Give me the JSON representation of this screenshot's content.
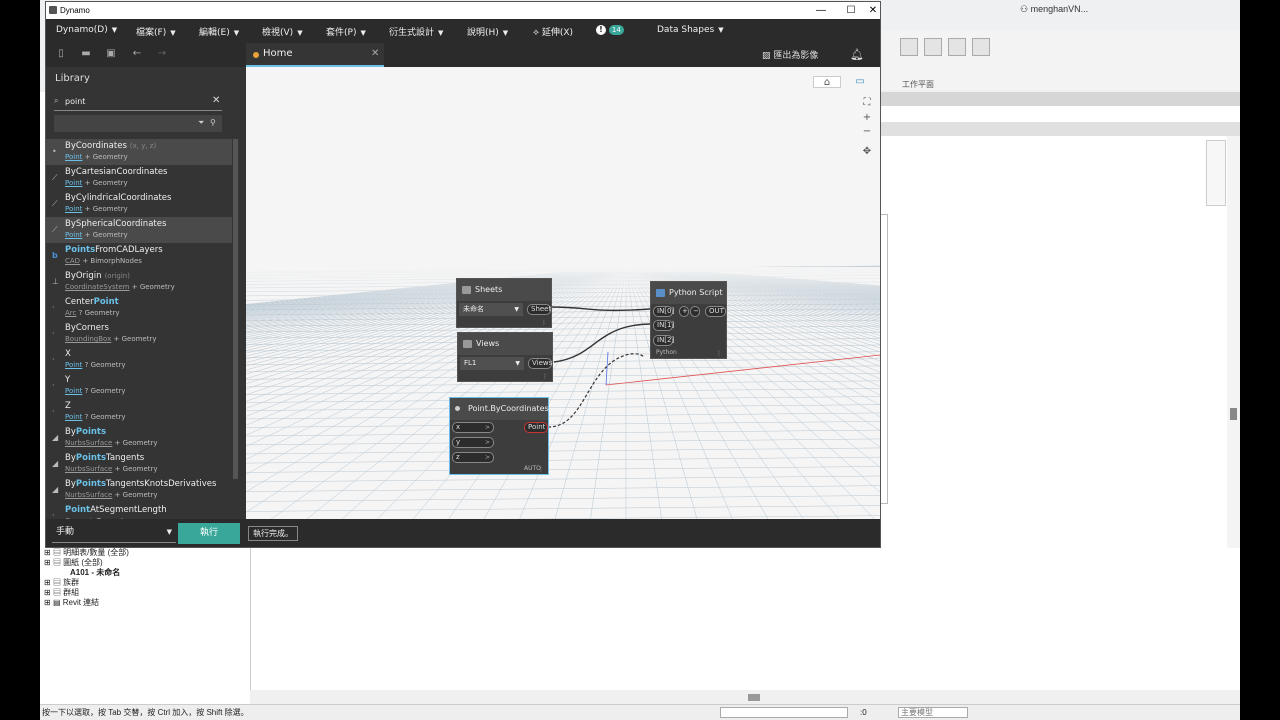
{
  "revit": {
    "user": "menghanVN...",
    "ribbon_panel_label": "工作平面",
    "tree": {
      "items": [
        {
          "label": "明細表/數量 (全部)",
          "bold": false
        },
        {
          "label": "圖紙 (全部)",
          "bold": false
        },
        {
          "label": "A101 - 未命名",
          "bold": true
        },
        {
          "label": "族群",
          "bold": false
        },
        {
          "label": "群組",
          "bold": false
        },
        {
          "label": "Revit 連結",
          "bold": false
        }
      ]
    },
    "status_text": "按一下以選取，按 Tab 交替，按 Ctrl 加入，按 Shift 除選。",
    "status_zero": ":0",
    "status_model": "主要模型"
  },
  "window": {
    "title": "Dynamo",
    "minimize": "—",
    "maximize": "☐",
    "close": "✕"
  },
  "menu": [
    {
      "label": "Dynamo(D)"
    },
    {
      "label": "檔案(F)"
    },
    {
      "label": "編輯(E)"
    },
    {
      "label": "檢視(V)"
    },
    {
      "label": "套件(P)"
    },
    {
      "label": "衍生式設計"
    },
    {
      "label": "說明(H)"
    },
    {
      "label": "延伸(X)"
    },
    {
      "label": "Data Shapes"
    }
  ],
  "notification_count": "14",
  "tab": {
    "label": "Home",
    "close": "✕"
  },
  "export_label": "匯出為影像",
  "library": {
    "title": "Library",
    "search_value": "point",
    "items": [
      {
        "name_plain": "ByCoordinates",
        "name_hl": "",
        "name_rest": "",
        "args": "(x, y, z)",
        "cat": "Point",
        "sep": "+",
        "parent": "Geometry",
        "selected": true,
        "icon": "•"
      },
      {
        "name_plain": "ByCartesianCoordinates",
        "name_hl": "",
        "name_rest": "",
        "args": "",
        "cat": "Point",
        "sep": "+",
        "parent": "Geometry",
        "selected": false,
        "icon": "⟋"
      },
      {
        "name_plain": "ByCylindricalCoordinates",
        "name_hl": "",
        "name_rest": "",
        "args": "",
        "cat": "Point",
        "sep": "+",
        "parent": "Geometry",
        "selected": false,
        "icon": "⟋"
      },
      {
        "name_plain": "BySphericalCoordinates",
        "name_hl": "",
        "name_rest": "",
        "args": "",
        "cat": "Point",
        "sep": "+",
        "parent": "Geometry",
        "selected": true,
        "icon": "⟋"
      },
      {
        "name_plain": "",
        "name_hl": "Points",
        "name_rest": "FromCADLayers",
        "args": "",
        "cat": "CAD",
        "sep": "+",
        "parent": "BimorphNodes",
        "selected": false,
        "icon": "b"
      },
      {
        "name_plain": "ByOrigin",
        "name_hl": "",
        "name_rest": "",
        "args": "(origin)",
        "cat": "CoordinateSystem",
        "sep": "+",
        "parent": "Geometry",
        "selected": false,
        "icon": "⊥"
      },
      {
        "name_plain": "Center",
        "name_hl": "Point",
        "name_rest": "",
        "args": "",
        "cat": "Arc",
        "sep": "?",
        "parent": "Geometry",
        "selected": false,
        "icon": "·"
      },
      {
        "name_plain": "ByCorners",
        "name_hl": "",
        "name_rest": "",
        "args": "",
        "cat": "BoundingBox",
        "sep": "+",
        "parent": "Geometry",
        "selected": false,
        "icon": "·"
      },
      {
        "name_plain": "X",
        "name_hl": "",
        "name_rest": "",
        "args": "",
        "cat": "Point",
        "sep": "?",
        "parent": "Geometry",
        "selected": false,
        "icon": "·"
      },
      {
        "name_plain": "Y",
        "name_hl": "",
        "name_rest": "",
        "args": "",
        "cat": "Point",
        "sep": "?",
        "parent": "Geometry",
        "selected": false,
        "icon": "·"
      },
      {
        "name_plain": "Z",
        "name_hl": "",
        "name_rest": "",
        "args": "",
        "cat": "Point",
        "sep": "?",
        "parent": "Geometry",
        "selected": false,
        "icon": "·"
      },
      {
        "name_plain": "By",
        "name_hl": "Points",
        "name_rest": "",
        "args": "",
        "cat": "NurbsSurface",
        "sep": "+",
        "parent": "Geometry",
        "selected": false,
        "icon": "◢"
      },
      {
        "name_plain": "By",
        "name_hl": "Points",
        "name_rest": "Tangents",
        "args": "",
        "cat": "NurbsSurface",
        "sep": "+",
        "parent": "Geometry",
        "selected": false,
        "icon": "◢"
      },
      {
        "name_plain": "By",
        "name_hl": "Points",
        "name_rest": "TangentsKnotsDerivatives",
        "args": "",
        "cat": "NurbsSurface",
        "sep": "+",
        "parent": "Geometry",
        "selected": false,
        "icon": "◢"
      },
      {
        "name_plain": "",
        "name_hl": "Point",
        "name_rest": "AtSegmentLength",
        "args": "",
        "cat": "Curve",
        "sep": "+",
        "parent": "Geometry",
        "selected": false,
        "icon": "·"
      }
    ]
  },
  "nodes": {
    "sheets": {
      "title": "Sheets",
      "dropdown": "未命名",
      "output": "Sheet"
    },
    "views": {
      "title": "Views",
      "dropdown": "FL1",
      "output": "Views"
    },
    "python": {
      "title": "Python Script",
      "inputs": [
        "IN[0]",
        "IN[1]",
        "IN[2]"
      ],
      "output": "OUT",
      "plus": "+",
      "minus": "−",
      "footer": "Python"
    },
    "point": {
      "title": "Point.ByCoordinates",
      "inputs": [
        "x",
        "y",
        "z"
      ],
      "output": "Point",
      "footer": "AUTO"
    }
  },
  "bottom": {
    "run_mode": "手動",
    "run_button": "執行",
    "status": "執行完成。"
  },
  "colors": {
    "accent": "#3aa79b",
    "highlight": "#6ac0e7",
    "dark": "#2b2b2b"
  }
}
